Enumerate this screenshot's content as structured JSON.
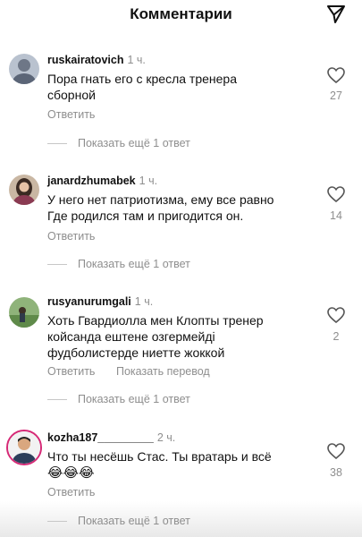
{
  "header": {
    "title": "Комментарии",
    "send_icon": "send-icon"
  },
  "comments": [
    {
      "username": "ruskairatovich",
      "time": "1 ч.",
      "text": "Пора гнать его с кресла тренера сборной",
      "reply_label": "Ответить",
      "likes": "27",
      "more_replies": "Показать ещё 1 ответ"
    },
    {
      "username": "janardzhumabek",
      "time": "1 ч.",
      "text": "У него нет патриотизма, ему все равно Где родился там и пригодится он.",
      "reply_label": "Ответить",
      "likes": "14",
      "more_replies": "Показать ещё 1 ответ"
    },
    {
      "username": "rusyanurumgali",
      "time": "1 ч.",
      "text": "Хоть Гвардиолла мен Клопты тренер койсанда ештене озгермейді фудболистерде ниетте жоккой",
      "reply_label": "Ответить",
      "translate_label": "Показать перевод",
      "likes": "2",
      "more_replies": "Показать ещё 1 ответ"
    },
    {
      "username": "kozha187_________",
      "time": "2 ч.",
      "text": "Что ты несёшь Стас. Ты вратарь и всё",
      "emoji": "😂😂😂",
      "reply_label": "Ответить",
      "likes": "38",
      "more_replies": "Показать ещё 1 ответ"
    }
  ]
}
